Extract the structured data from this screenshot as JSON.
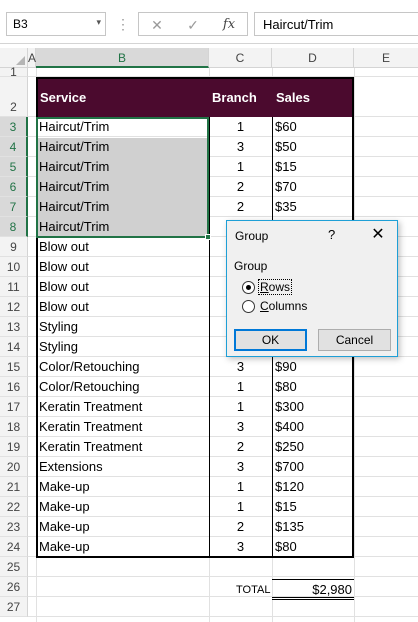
{
  "formula_bar": {
    "name_box": "B3",
    "name_box_arrow": "▾",
    "dots": "⋮",
    "cancel_icon": "✕",
    "enter_icon": "✓",
    "fx_label": "fx",
    "formula": "Haircut/Trim"
  },
  "columns": [
    "A",
    "B",
    "C",
    "D",
    "E"
  ],
  "rows": [
    "1",
    "2",
    "3",
    "4",
    "5",
    "6",
    "7",
    "8",
    "9",
    "10",
    "11",
    "12",
    "13",
    "14",
    "15",
    "16",
    "17",
    "18",
    "19",
    "20",
    "21",
    "22",
    "23",
    "24",
    "25",
    "26",
    "27"
  ],
  "table": {
    "headers": {
      "service": "Service",
      "branch": "Branch",
      "sales": "Sales"
    },
    "data": [
      {
        "service": "Haircut/Trim",
        "branch": "1",
        "sales": "$60"
      },
      {
        "service": "Haircut/Trim",
        "branch": "3",
        "sales": "$50"
      },
      {
        "service": "Haircut/Trim",
        "branch": "1",
        "sales": "$15"
      },
      {
        "service": "Haircut/Trim",
        "branch": "2",
        "sales": "$70"
      },
      {
        "service": "Haircut/Trim",
        "branch": "2",
        "sales": "$35"
      },
      {
        "service": "Haircut/Trim",
        "branch": "",
        "sales": ""
      },
      {
        "service": "Blow out",
        "branch": "",
        "sales": ""
      },
      {
        "service": "Blow out",
        "branch": "",
        "sales": ""
      },
      {
        "service": "Blow out",
        "branch": "",
        "sales": ""
      },
      {
        "service": "Blow out",
        "branch": "",
        "sales": ""
      },
      {
        "service": "Styling",
        "branch": "",
        "sales": ""
      },
      {
        "service": "Styling",
        "branch": "",
        "sales": ""
      },
      {
        "service": "Color/Retouching",
        "branch": "3",
        "sales": "$90"
      },
      {
        "service": "Color/Retouching",
        "branch": "1",
        "sales": "$80"
      },
      {
        "service": "Keratin Treatment",
        "branch": "1",
        "sales": "$300"
      },
      {
        "service": "Keratin Treatment",
        "branch": "3",
        "sales": "$400"
      },
      {
        "service": "Keratin Treatment",
        "branch": "2",
        "sales": "$250"
      },
      {
        "service": "Extensions",
        "branch": "3",
        "sales": "$700"
      },
      {
        "service": "Make-up",
        "branch": "1",
        "sales": "$120"
      },
      {
        "service": "Make-up",
        "branch": "1",
        "sales": "$15"
      },
      {
        "service": "Make-up",
        "branch": "2",
        "sales": "$135"
      },
      {
        "service": "Make-up",
        "branch": "3",
        "sales": "$80"
      }
    ],
    "total_label": "TOTAL",
    "total_value": "$2,980"
  },
  "colors": {
    "header_fill": "#4b0a2e",
    "selection_border": "#217346",
    "selection_fill": "#d0d0d0",
    "dialog_border": "#1e9fd6"
  },
  "dialog": {
    "title": "Group",
    "help": "?",
    "close_icon": "✕",
    "group_label": "Group",
    "option_rows_prefix": "",
    "option_rows_ul": "R",
    "option_rows_rest": "ows",
    "option_columns_ul": "C",
    "option_columns_rest": "olumns",
    "selected": "Rows",
    "ok": "OK",
    "cancel": "Cancel"
  }
}
